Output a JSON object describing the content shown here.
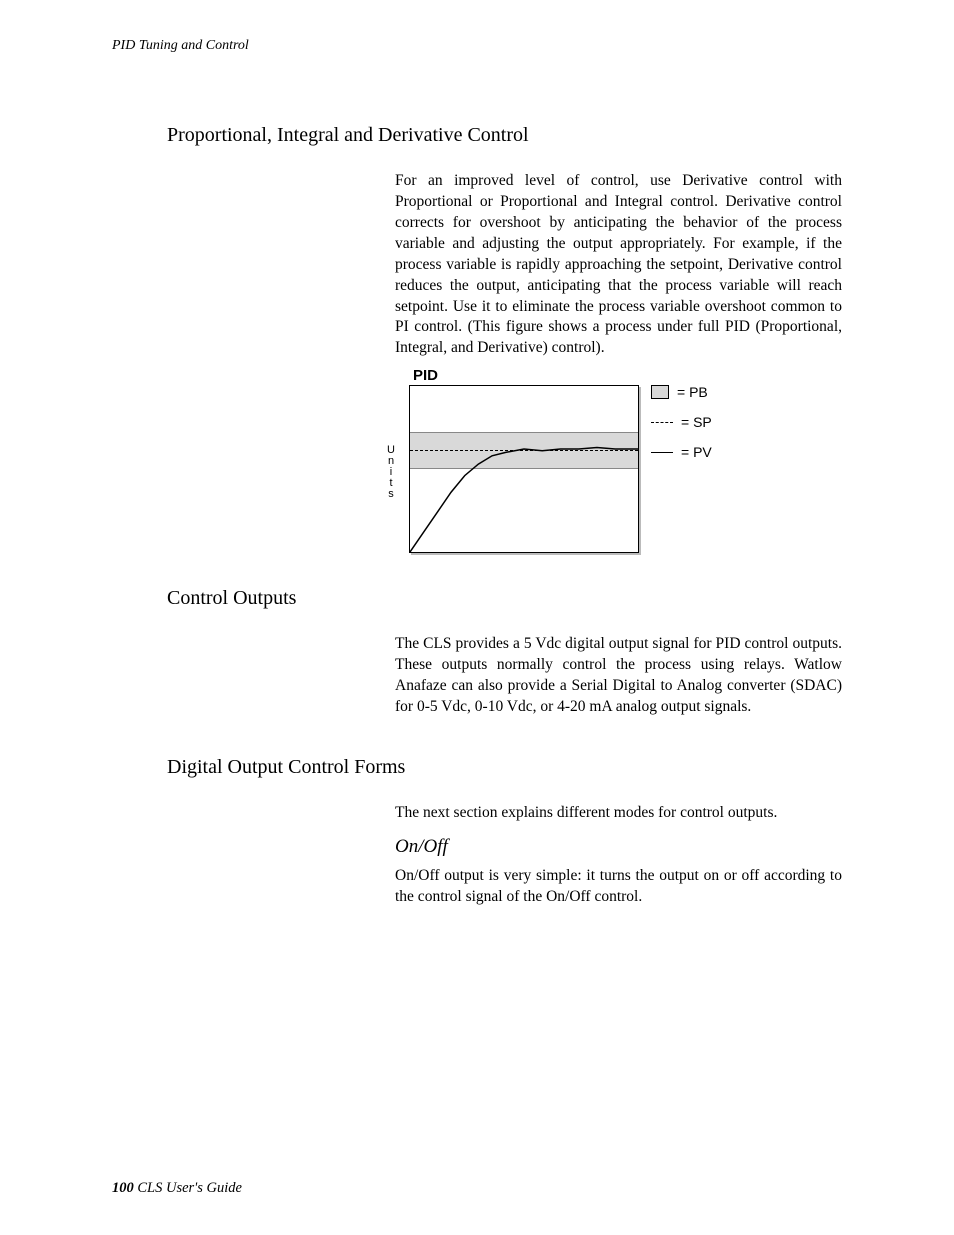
{
  "header": {
    "running_title": "PID Tuning and Control"
  },
  "sections": {
    "pid": {
      "heading": "Proportional, Integral and Derivative Control",
      "body": "For an improved level of control, use Derivative control with Proportional or Proportional and Integral control. Derivative control corrects for overshoot by anticipating the behavior of the process variable and adjusting the output appropriately. For example, if the process variable is rapidly approaching the setpoint, Derivative control reduces the output, anticipating that the process variable will reach setpoint. Use it to eliminate the process variable overshoot common to PI control. (This figure shows a process under full PID (Proportional, Integral, and Derivative) control)."
    },
    "control_outputs": {
      "heading": "Control Outputs",
      "body": "The CLS provides a 5 Vdc digital output signal for PID control outputs. These outputs normally control the process using relays. Watlow Anafaze can also provide a Serial Digital to Analog converter (SDAC) for 0-5 Vdc, 0-10 Vdc, or 4-20 mA analog output signals."
    },
    "digital_forms": {
      "heading": "Digital Output Control Forms",
      "intro": "The next section explains different modes for control outputs.",
      "onoff_heading": "On/Off",
      "onoff_body": "On/Off output is very simple: it turns the output on or off according to the control signal of the On/Off control."
    }
  },
  "chart_data": {
    "type": "line",
    "title": "PID",
    "ylabel": "Units",
    "xlabel": "",
    "xlim": [
      0,
      100
    ],
    "ylim": [
      0,
      100
    ],
    "pb_band": {
      "lower": 51,
      "upper": 73
    },
    "sp": 62,
    "series": [
      {
        "name": "PV",
        "x": [
          0,
          6,
          12,
          18,
          24,
          30,
          36,
          42,
          50,
          58,
          66,
          74,
          82,
          90,
          100
        ],
        "y": [
          0,
          12,
          24,
          36,
          46,
          53,
          58,
          60,
          62,
          61,
          62,
          62,
          63,
          62,
          62
        ]
      }
    ],
    "legend": {
      "pb": "= PB",
      "sp": "= SP",
      "pv": "= PV"
    }
  },
  "footer": {
    "page_number": "100",
    "doc_title": "CLS User's Guide"
  }
}
